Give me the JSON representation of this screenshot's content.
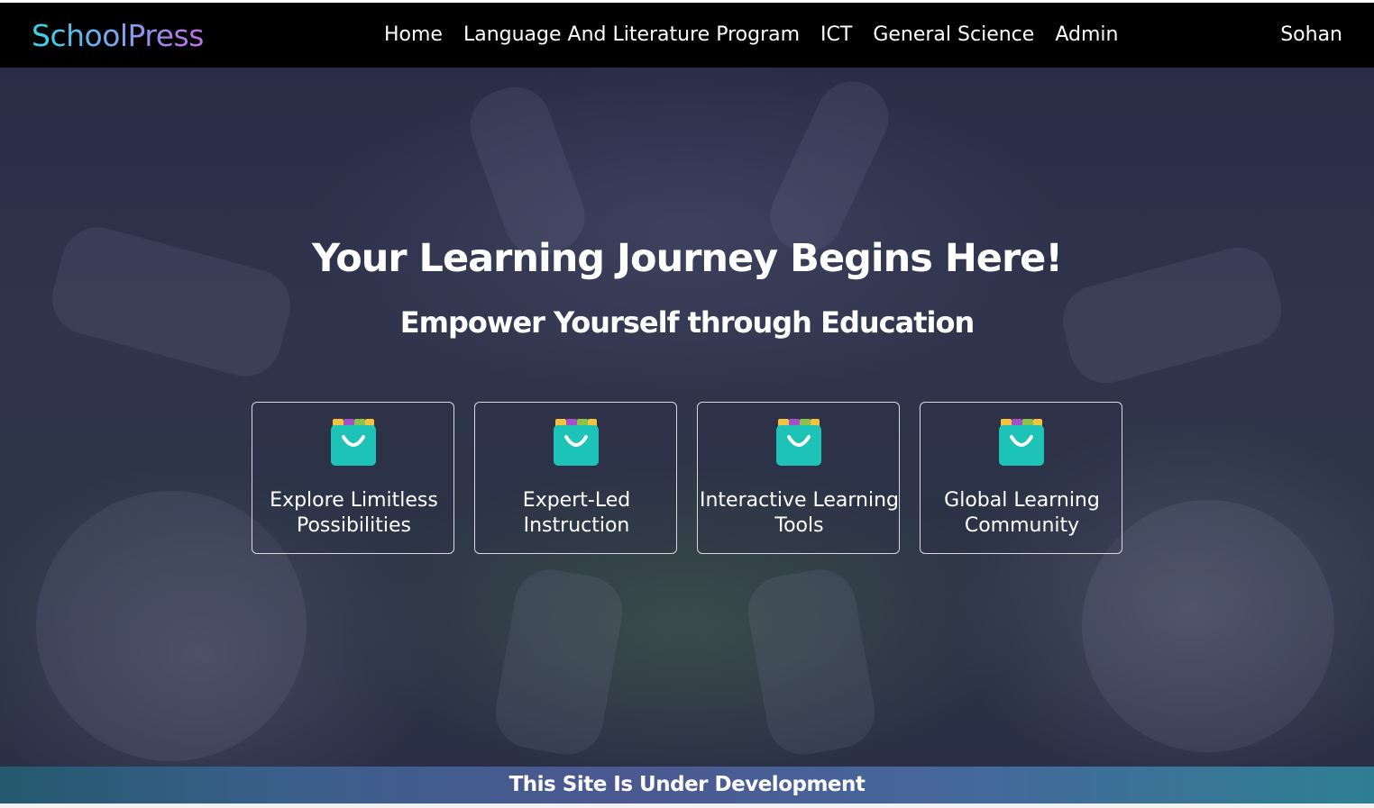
{
  "navbar": {
    "brand": "SchoolPress",
    "links": [
      {
        "label": "Home"
      },
      {
        "label": "Language And Literature Program"
      },
      {
        "label": "ICT"
      },
      {
        "label": "General Science"
      },
      {
        "label": "Admin"
      }
    ],
    "user": "Sohan"
  },
  "hero": {
    "title": "Your Learning Journey Begins Here!",
    "subtitle": "Empower Yourself through Education",
    "cards": [
      {
        "label": "Explore Limitless Possibilities",
        "icon": "shopping-bag-icon"
      },
      {
        "label": "Expert-Led Instruction",
        "icon": "shopping-bag-icon"
      },
      {
        "label": "Interactive Learning Tools",
        "icon": "shopping-bag-icon"
      },
      {
        "label": "Global Learning Community",
        "icon": "shopping-bag-icon"
      }
    ]
  },
  "banner": {
    "text": "This Site Is Under Development"
  },
  "colors": {
    "navbar_bg": "#000000",
    "brand_gradient_start": "#35d6e8",
    "brand_gradient_end": "#c06de6",
    "icon_teal": "#1cc3b6",
    "banner_start": "#24596f",
    "banner_mid": "#4b5890",
    "banner_end": "#2e7f93"
  }
}
